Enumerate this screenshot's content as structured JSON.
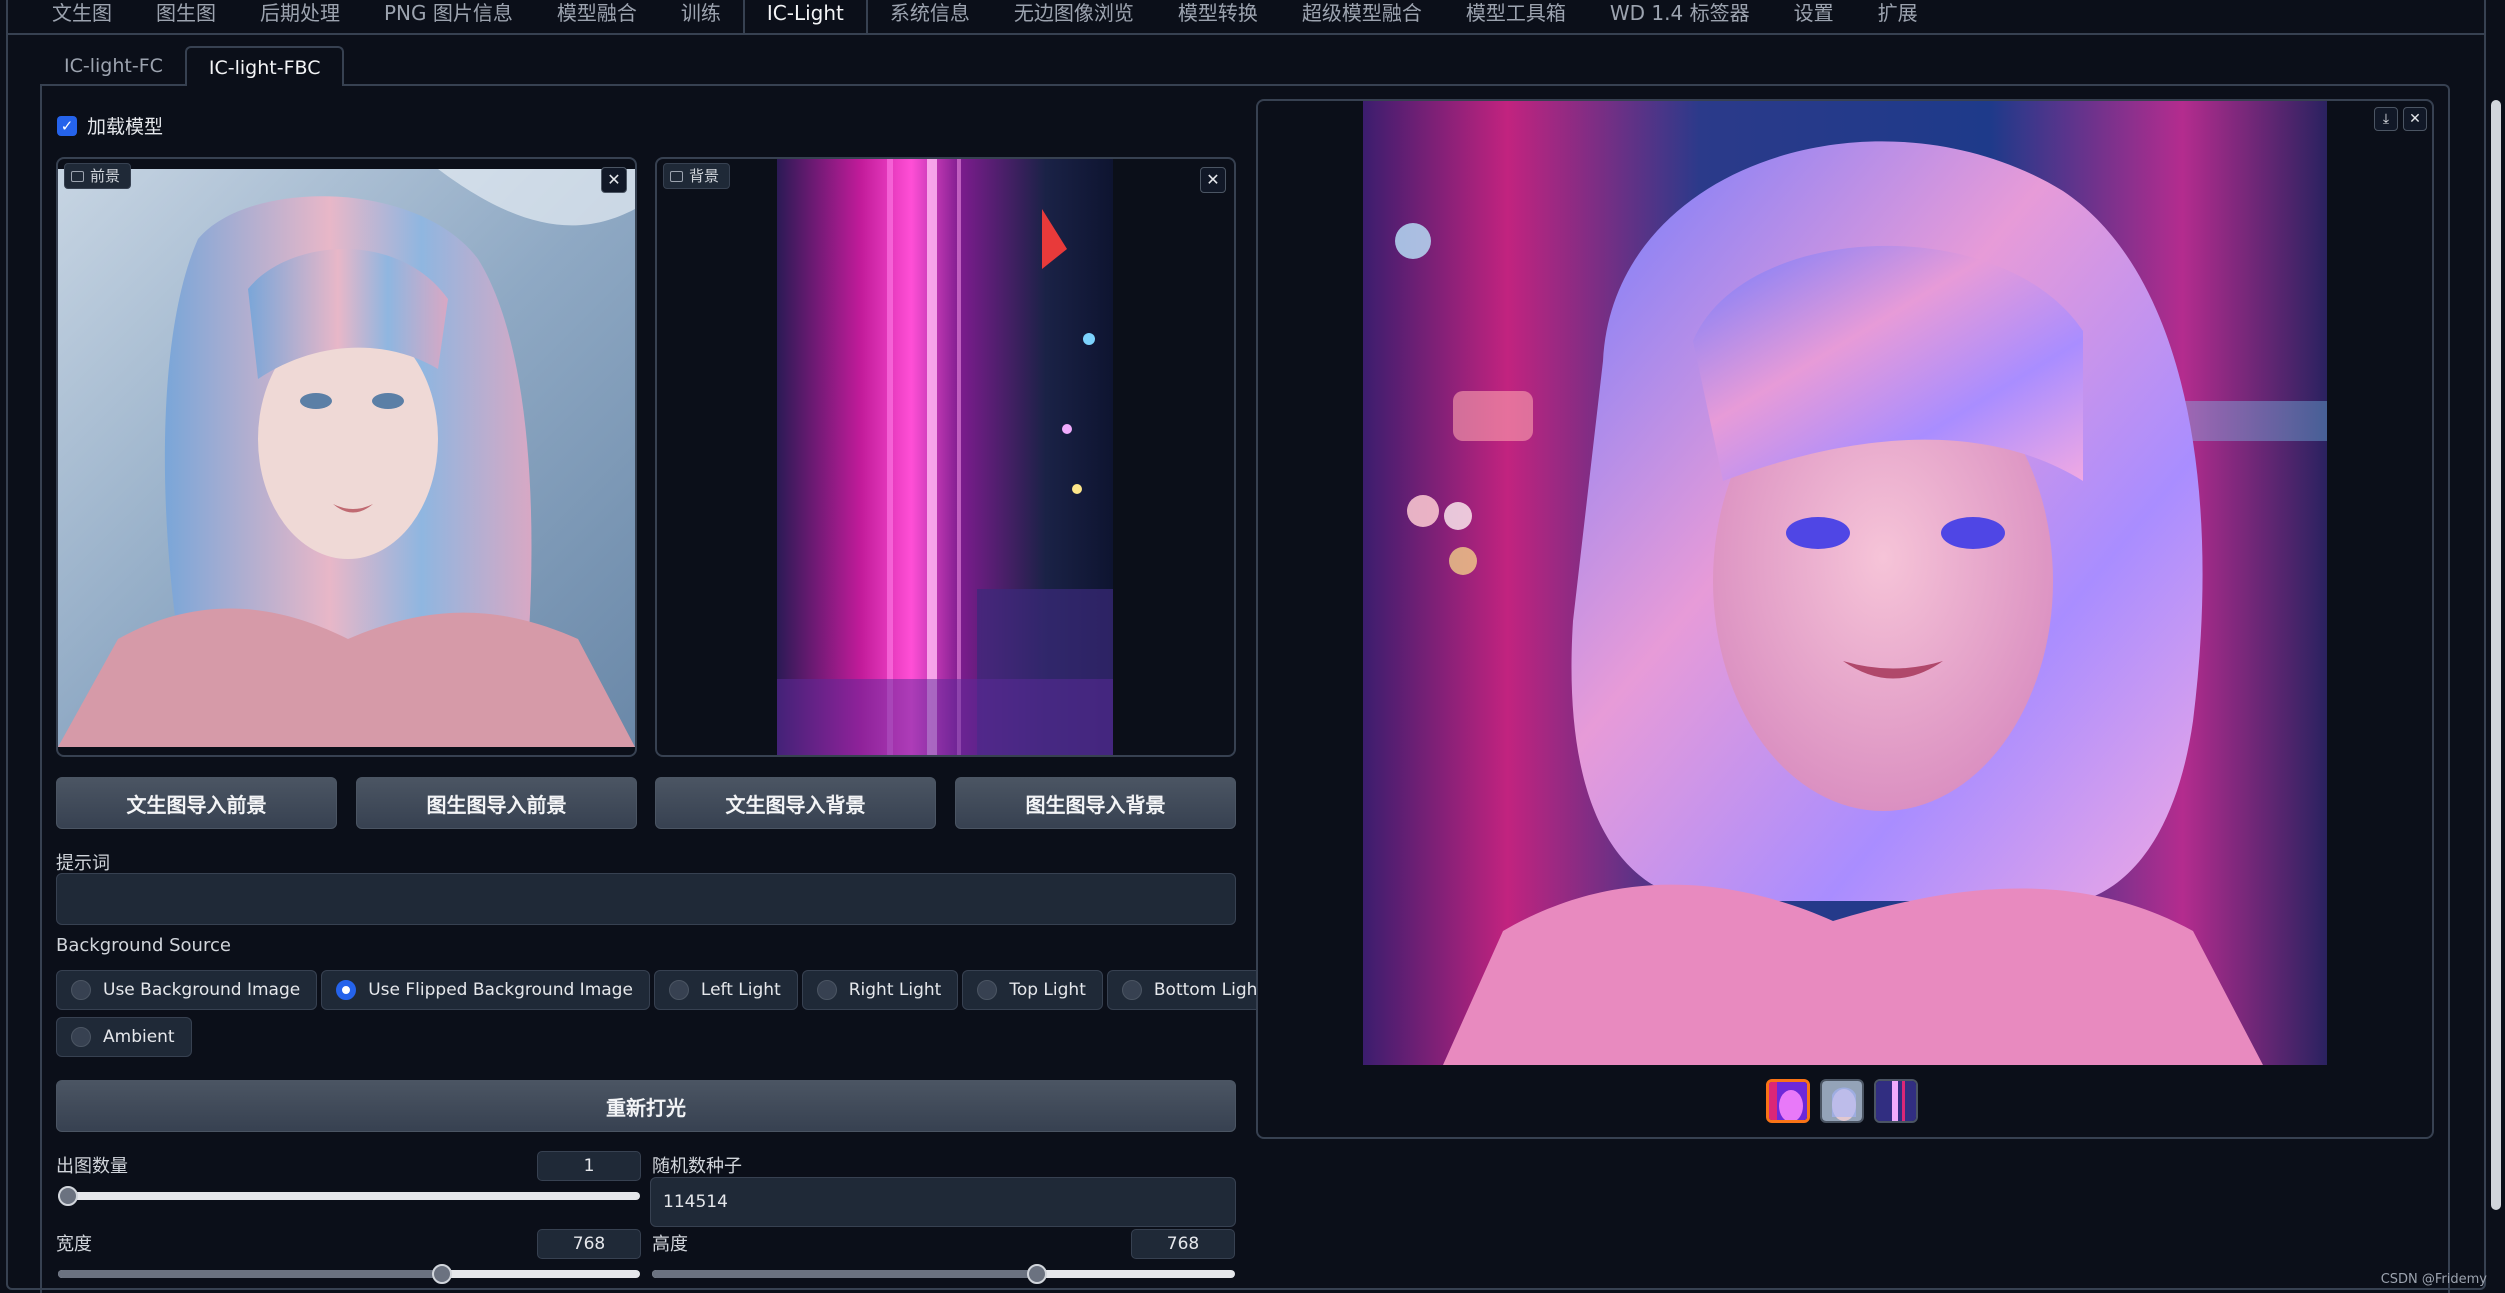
{
  "top_tabs": [
    "文生图",
    "图生图",
    "后期处理",
    "PNG 图片信息",
    "模型融合",
    "训练",
    "IC-Light",
    "系统信息",
    "无边图像浏览",
    "模型转换",
    "超级模型融合",
    "模型工具箱",
    "WD 1.4 标签器",
    "设置",
    "扩展"
  ],
  "active_top_tab": "IC-Light",
  "sub_tabs": [
    "IC-light-FC",
    "IC-light-FBC"
  ],
  "active_sub_tab": "IC-light-FBC",
  "load_model": {
    "label": "加载模型",
    "checked": true
  },
  "foreground": {
    "label": "前景"
  },
  "background": {
    "label": "背景"
  },
  "buttons": {
    "txt2img_fg": "文生图导入前景",
    "img2img_fg": "图生图导入前景",
    "txt2img_bg": "文生图导入背景",
    "img2img_bg": "图生图导入背景",
    "relight": "重新打光"
  },
  "prompt": {
    "label": "提示词",
    "value": ""
  },
  "bg_source": {
    "label": "Background Source",
    "options": [
      "Use Background Image",
      "Use Flipped Background Image",
      "Left Light",
      "Right Light",
      "Top Light",
      "Bottom Light",
      "Ambient"
    ],
    "selected": "Use Flipped Background Image"
  },
  "batch_count": {
    "label": "出图数量",
    "value": "1",
    "fraction": 0.0
  },
  "seed": {
    "label": "随机数种子",
    "value": "114514"
  },
  "width": {
    "label": "宽度",
    "value": "768",
    "fraction": 0.66
  },
  "height": {
    "label": "高度",
    "value": "768",
    "fraction": 0.66
  },
  "gallery": {
    "thumbnail_count": 3,
    "selected_index": 0
  },
  "watermark": "CSDN @Fridemy",
  "colors": {
    "accent": "#2563eb",
    "selected_thumb": "#f97316",
    "bg": "#0b0f19"
  },
  "icons": [
    "image-icon",
    "close-icon",
    "download-icon",
    "check-icon"
  ]
}
